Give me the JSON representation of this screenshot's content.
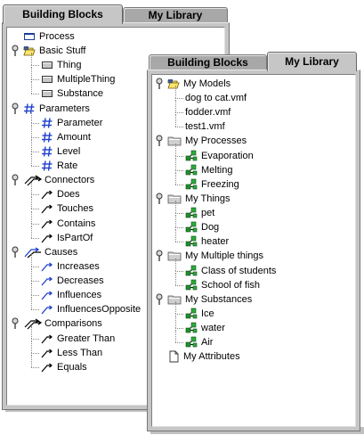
{
  "back_panel": {
    "tabs": [
      {
        "label": "Building Blocks",
        "selected": true
      },
      {
        "label": "My Library",
        "selected": false
      }
    ],
    "tree": [
      {
        "label": "Process",
        "icon": "process-icon",
        "level": 0
      },
      {
        "label": "Basic Stuff",
        "icon": "folder-open-icon",
        "level": 0,
        "expanded": true
      },
      {
        "label": "Thing",
        "icon": "thing-icon",
        "level": 1
      },
      {
        "label": "MultipleThing",
        "icon": "thing-icon",
        "level": 1
      },
      {
        "label": "Substance",
        "icon": "thing-icon",
        "level": 1
      },
      {
        "label": "Parameters",
        "icon": "parameter-icon",
        "level": 0,
        "expanded": true
      },
      {
        "label": "Parameter",
        "icon": "parameter-icon",
        "level": 1
      },
      {
        "label": "Amount",
        "icon": "parameter-icon",
        "level": 1
      },
      {
        "label": "Level",
        "icon": "parameter-icon",
        "level": 1
      },
      {
        "label": "Rate",
        "icon": "parameter-icon",
        "level": 1
      },
      {
        "label": "Connectors",
        "icon": "connectors-icon",
        "level": 0,
        "expanded": true
      },
      {
        "label": "Does",
        "icon": "connector-icon",
        "level": 1
      },
      {
        "label": "Touches",
        "icon": "connector-icon",
        "level": 1
      },
      {
        "label": "Contains",
        "icon": "connector-icon",
        "level": 1
      },
      {
        "label": "IsPartOf",
        "icon": "connector-icon",
        "level": 1
      },
      {
        "label": "Causes",
        "icon": "causes-icon",
        "level": 0,
        "expanded": true
      },
      {
        "label": "Increases",
        "icon": "cause-icon",
        "level": 1
      },
      {
        "label": "Decreases",
        "icon": "cause-icon",
        "level": 1
      },
      {
        "label": "Influences",
        "icon": "cause-icon",
        "level": 1
      },
      {
        "label": "InfluencesOpposite",
        "icon": "cause-icon",
        "level": 1
      },
      {
        "label": "Comparisons",
        "icon": "connectors-icon",
        "level": 0,
        "expanded": true
      },
      {
        "label": "Greater Than",
        "icon": "connector-icon",
        "level": 1
      },
      {
        "label": "Less Than",
        "icon": "connector-icon",
        "level": 1
      },
      {
        "label": "Equals",
        "icon": "connector-icon",
        "level": 1
      }
    ]
  },
  "front_panel": {
    "tabs": [
      {
        "label": "Building Blocks",
        "selected": false
      },
      {
        "label": "My Library",
        "selected": true
      }
    ],
    "tree": [
      {
        "label": "My Models",
        "icon": "folder-open-icon",
        "level": 0,
        "expanded": true
      },
      {
        "label": "dog to cat.vmf",
        "icon": "none",
        "level": 1
      },
      {
        "label": "fodder.vmf",
        "icon": "none",
        "level": 1
      },
      {
        "label": "test1.vmf",
        "icon": "none",
        "level": 1
      },
      {
        "label": "My Processes",
        "icon": "folder-icon",
        "level": 0,
        "expanded": true
      },
      {
        "label": "Evaporation",
        "icon": "model-icon",
        "level": 1
      },
      {
        "label": "Melting",
        "icon": "model-icon",
        "level": 1
      },
      {
        "label": "Freezing",
        "icon": "model-icon",
        "level": 1
      },
      {
        "label": "My Things",
        "icon": "folder-icon",
        "level": 0,
        "expanded": true
      },
      {
        "label": "pet",
        "icon": "model-icon",
        "level": 1
      },
      {
        "label": "Dog",
        "icon": "model-icon",
        "level": 1
      },
      {
        "label": "heater",
        "icon": "model-icon",
        "level": 1
      },
      {
        "label": "My Multiple things",
        "icon": "folder-icon",
        "level": 0,
        "expanded": true
      },
      {
        "label": "Class of students",
        "icon": "model-icon",
        "level": 1
      },
      {
        "label": "School of fish",
        "icon": "model-icon",
        "level": 1
      },
      {
        "label": "My Substances",
        "icon": "folder-icon",
        "level": 0,
        "expanded": true
      },
      {
        "label": "Ice",
        "icon": "model-icon",
        "level": 1
      },
      {
        "label": "water",
        "icon": "model-icon",
        "level": 1
      },
      {
        "label": "Air",
        "icon": "model-icon",
        "level": 1
      },
      {
        "label": "My Attributes",
        "icon": "document-icon",
        "level": 0
      }
    ]
  }
}
